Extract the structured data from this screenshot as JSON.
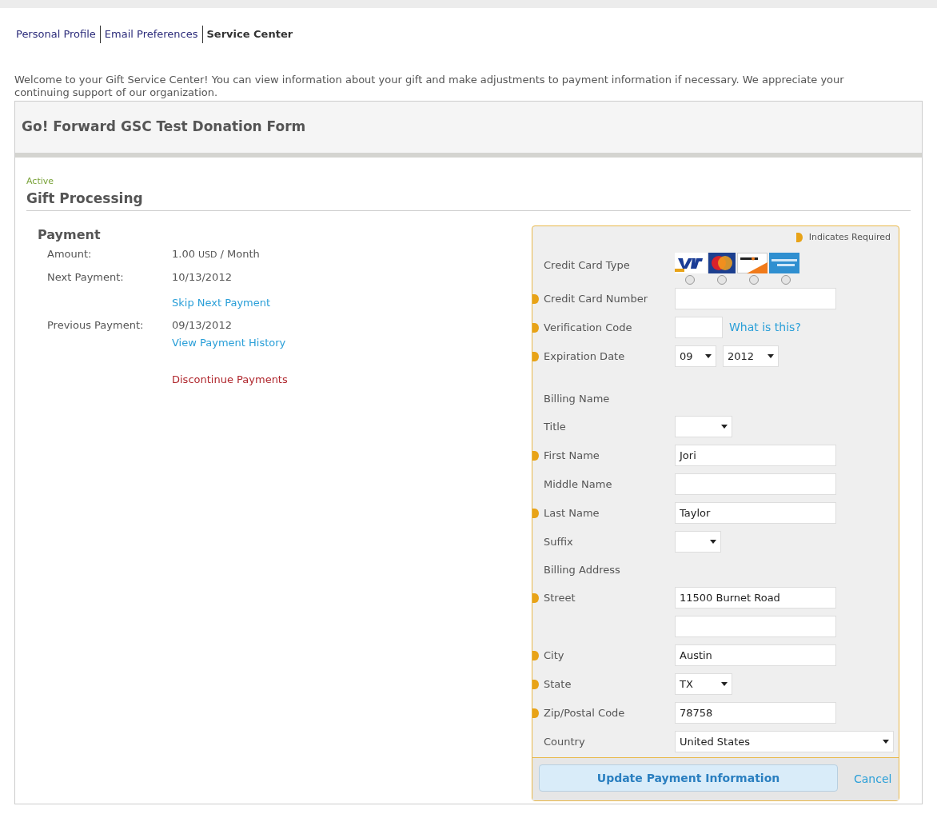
{
  "tabs": [
    {
      "label": "Personal Profile",
      "selected": false
    },
    {
      "label": "Email Preferences",
      "selected": false
    },
    {
      "label": "Service Center",
      "selected": true
    }
  ],
  "intro": "Welcome to your Gift Service Center! You can view information about your gift and make adjustments to payment information if necessary. We appreciate your continuing support of our organization.",
  "form_title": "Go! Forward GSC Test Donation Form",
  "status": "Active",
  "section_title": "Gift Processing",
  "payment": {
    "heading": "Payment",
    "items": [
      {
        "kind": "amount",
        "label": "Amount:",
        "value": "1.00",
        "currency": "USD",
        "period": "/ Month"
      },
      {
        "kind": "field",
        "label": "Next Payment:",
        "value": "10/13/2012"
      },
      {
        "kind": "link",
        "text": "Skip Next Payment"
      },
      {
        "kind": "field",
        "label": "Previous Payment:",
        "value": "09/13/2012"
      },
      {
        "kind": "link",
        "text": "View Payment History"
      },
      {
        "kind": "danger-link",
        "text": "Discontinue Payments"
      }
    ]
  },
  "billing": {
    "required_legend": "Indicates Required",
    "rows": [
      {
        "kind": "card-type",
        "label": "Credit Card Type",
        "required": false,
        "options": [
          {
            "kind": "visa",
            "selected": false
          },
          {
            "kind": "mastercard",
            "selected": false
          },
          {
            "kind": "discover",
            "selected": false
          },
          {
            "kind": "amex",
            "selected": false
          }
        ]
      },
      {
        "kind": "input",
        "label": "Credit Card Number",
        "required": true
      },
      {
        "kind": "cvv",
        "label": "Verification Code",
        "required": true,
        "link": "What is this?"
      },
      {
        "kind": "expiry",
        "label": "Expiration Date",
        "required": true,
        "month": "09",
        "year": "2012"
      },
      {
        "kind": "spacer"
      },
      {
        "kind": "heading",
        "label": "Billing Name"
      },
      {
        "kind": "select",
        "label": "Title",
        "required": false
      },
      {
        "kind": "input",
        "label": "First Name",
        "required": true,
        "value": "Jori"
      },
      {
        "kind": "input",
        "label": "Middle Name",
        "required": false
      },
      {
        "kind": "input",
        "label": "Last Name",
        "required": true,
        "value": "Taylor"
      },
      {
        "kind": "small-select",
        "label": "Suffix",
        "required": false
      },
      {
        "kind": "heading",
        "label": "Billing Address"
      },
      {
        "kind": "input",
        "label": "Street",
        "required": true,
        "value": "11500 Burnet Road"
      },
      {
        "kind": "input",
        "required": false
      },
      {
        "kind": "input",
        "label": "City",
        "required": true,
        "value": "Austin"
      },
      {
        "kind": "select",
        "label": "State",
        "required": true,
        "value": "TX"
      },
      {
        "kind": "input",
        "label": "Zip/Postal Code",
        "required": true,
        "value": "78758"
      },
      {
        "kind": "wide-select",
        "label": "Country",
        "required": false,
        "value": "United States"
      }
    ],
    "submit": "Update Payment Information",
    "cancel": "Cancel"
  }
}
